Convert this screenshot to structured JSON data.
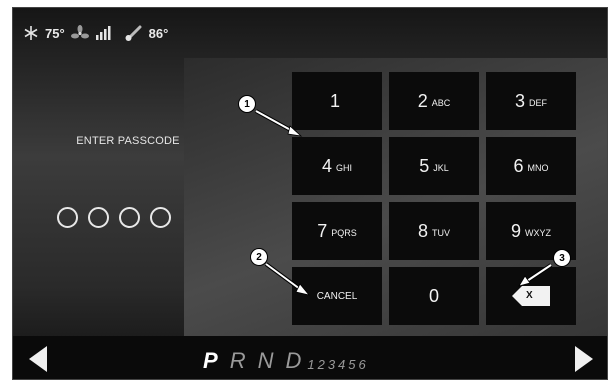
{
  "status": {
    "temperature_inside": "75°",
    "temperature_outside": "86°",
    "icons": [
      "snowflake-icon",
      "fan-icon",
      "signal-bars-icon",
      "thermometer-icon"
    ]
  },
  "passcode": {
    "label": "ENTER PASSCODE",
    "digit_slots": 4,
    "entered": 0
  },
  "keypad": {
    "keys": [
      {
        "num": "1",
        "letters": ""
      },
      {
        "num": "2",
        "letters": "ABC"
      },
      {
        "num": "3",
        "letters": "DEF"
      },
      {
        "num": "4",
        "letters": "GHI"
      },
      {
        "num": "5",
        "letters": "JKL"
      },
      {
        "num": "6",
        "letters": "MNO"
      },
      {
        "num": "7",
        "letters": "PQRS"
      },
      {
        "num": "8",
        "letters": "TUV"
      },
      {
        "num": "9",
        "letters": "WXYZ"
      }
    ],
    "cancel_label": "CANCEL",
    "zero_label": "0",
    "backspace_label": "X"
  },
  "gear": {
    "selected": "P",
    "main": [
      "P",
      "R",
      "N",
      "D"
    ],
    "numbers": "123456"
  },
  "callouts": [
    "1",
    "2",
    "3"
  ]
}
